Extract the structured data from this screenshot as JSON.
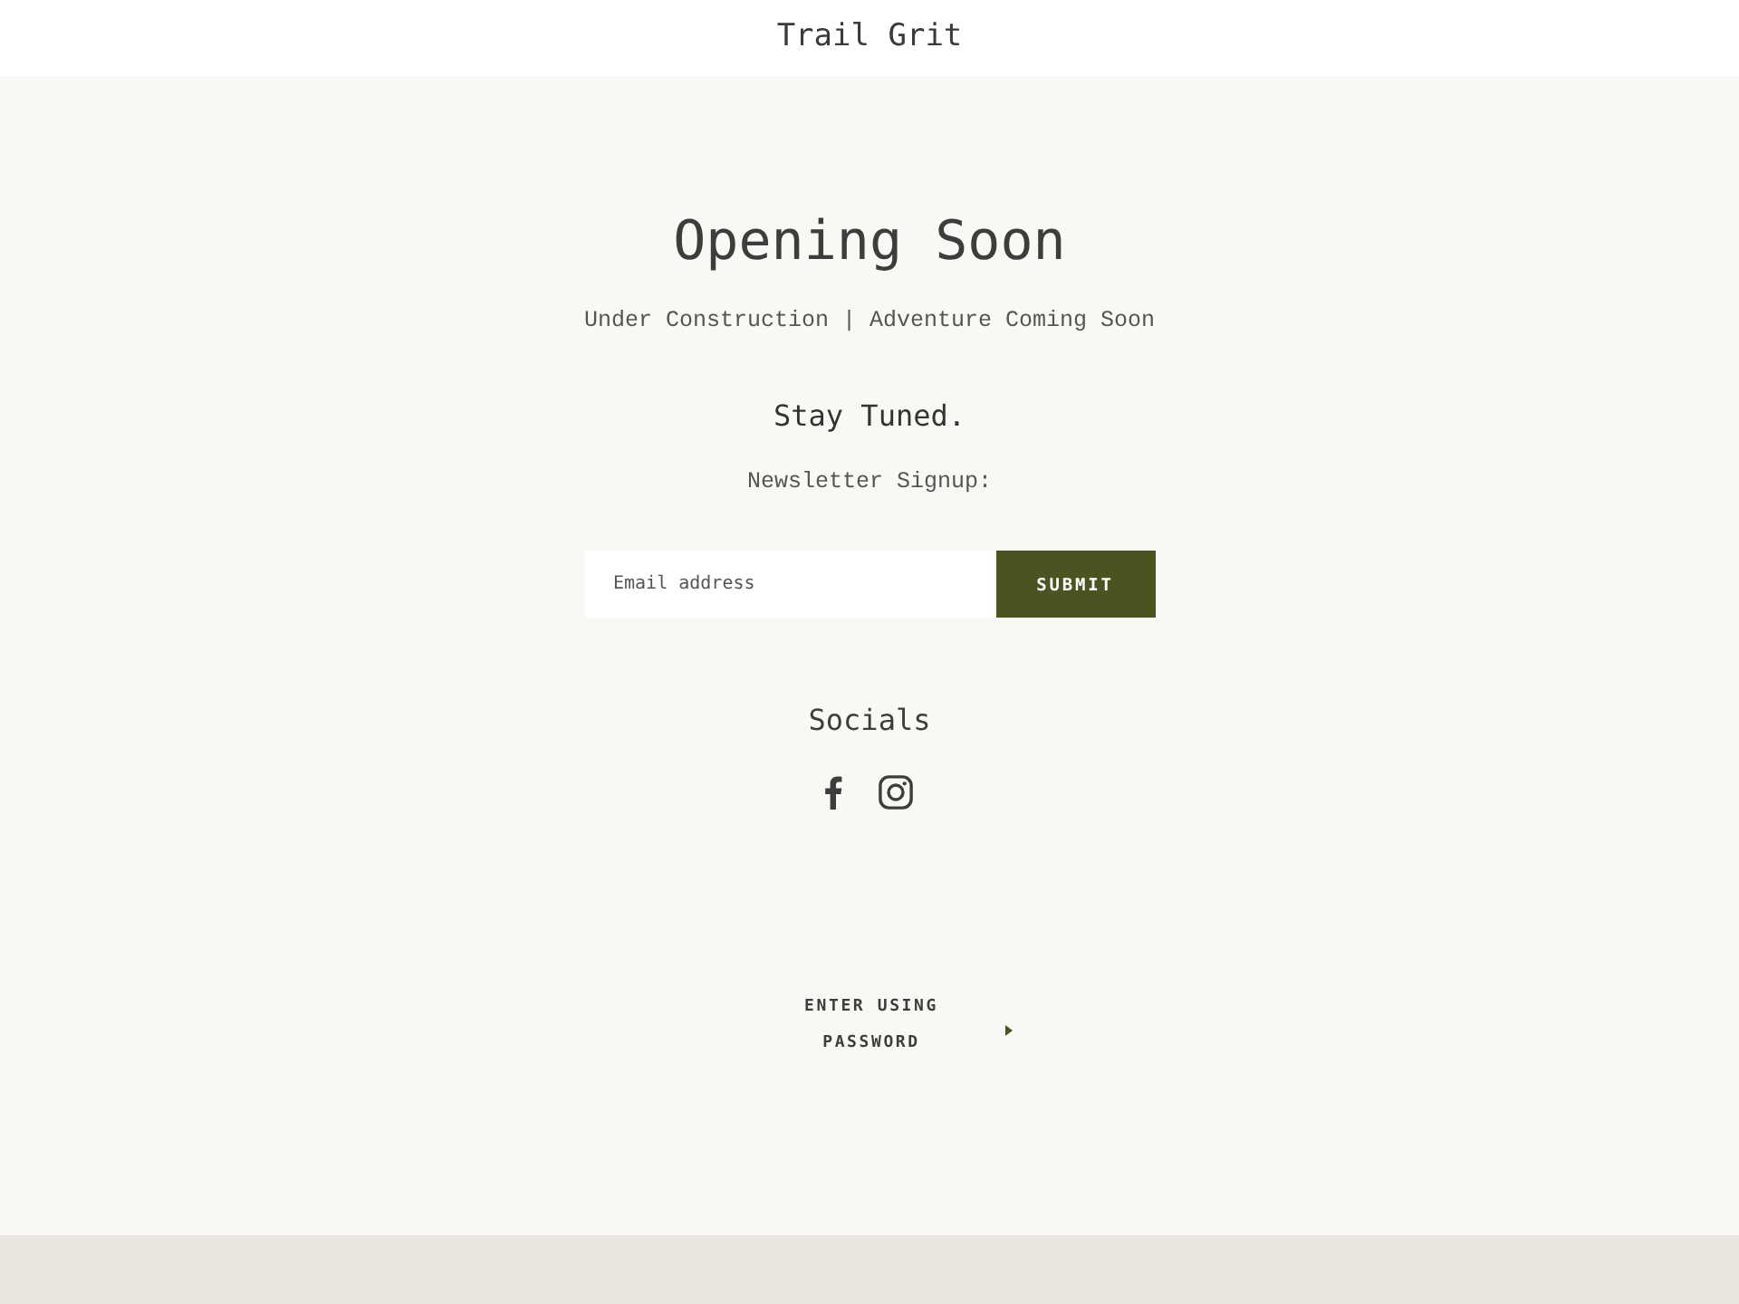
{
  "header": {
    "title": "Trail Grit"
  },
  "hero": {
    "heading": "Opening Soon",
    "subheading": "Under Construction | Adventure Coming Soon",
    "tagline": "Stay Tuned.",
    "newsletter_label": "Newsletter Signup:"
  },
  "newsletter_form": {
    "email_field": {
      "placeholder": "Email address"
    },
    "submit_button": "SUBMIT"
  },
  "socials": {
    "heading": "Socials",
    "links": [
      {
        "kind": "facebook"
      },
      {
        "kind": "instagram"
      }
    ]
  },
  "password_link": {
    "label": "ENTER USING PASSWORD"
  }
}
